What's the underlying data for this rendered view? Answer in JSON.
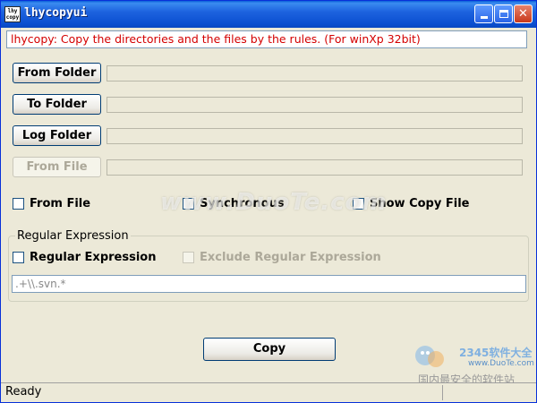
{
  "window": {
    "title": "lhycopyui",
    "icon_text": "lhy\ncopy"
  },
  "banner": {
    "text": "lhycopy: Copy the directories and the files by the rules.  (For winXp 32bit)"
  },
  "buttons": {
    "from_folder": "From Folder",
    "to_folder": "To Folder",
    "log_folder": "Log Folder",
    "from_file": "From File",
    "copy": "Copy"
  },
  "fields": {
    "from_folder": "",
    "to_folder": "",
    "log_folder": "",
    "from_file": ""
  },
  "options": {
    "from_file": "From File",
    "synchronous": "Synchronous",
    "show_copy_file": "Show Copy File"
  },
  "regex_group": {
    "title": "Regular Expression",
    "regular_expression": "Regular Expression",
    "exclude_regular_expression": "Exclude Regular Expression",
    "pattern_value": ".+\\\\.svn.*"
  },
  "status": {
    "text": "Ready"
  },
  "watermarks": {
    "center": "www.DuoTe.com",
    "logo_text": "2345软件大全",
    "logo_url": "www.DuoTe.com",
    "bottom": "国内最安全的软件站"
  },
  "colors": {
    "title_bar": "#0b4fd0",
    "banner_text": "#d40000",
    "window_bg": "#ece9d8"
  }
}
